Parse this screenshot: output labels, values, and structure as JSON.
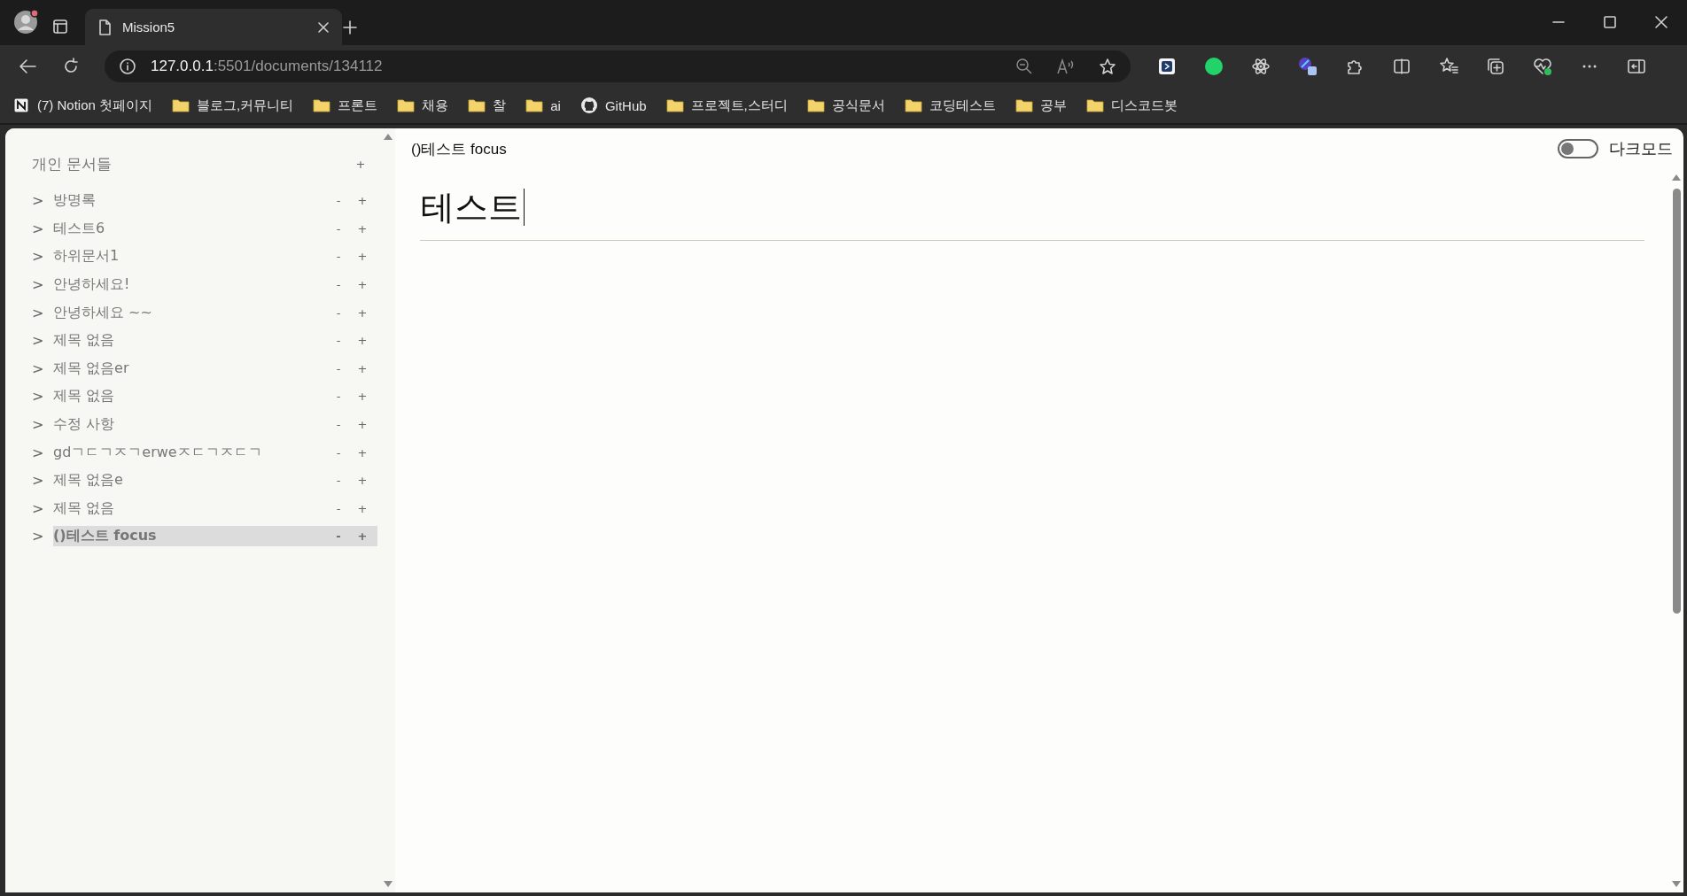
{
  "browser": {
    "tabs": [
      {
        "title": "Mission5",
        "selected": true
      }
    ],
    "address": {
      "host": "127.0.0.1",
      "path": ":5501/documents/134112"
    },
    "bookmarks": [
      {
        "kind": "notion",
        "label": "(7) Notion 첫페이지"
      },
      {
        "kind": "folder",
        "label": "블로그,커뮤니티"
      },
      {
        "kind": "folder",
        "label": "프론트"
      },
      {
        "kind": "folder",
        "label": "채용"
      },
      {
        "kind": "folder",
        "label": "찰"
      },
      {
        "kind": "folder",
        "label": "ai"
      },
      {
        "kind": "github",
        "label": "GitHub"
      },
      {
        "kind": "folder",
        "label": "프로젝트,스터디"
      },
      {
        "kind": "folder",
        "label": "공식문서"
      },
      {
        "kind": "folder",
        "label": "코딩테스트"
      },
      {
        "kind": "folder",
        "label": "공부"
      },
      {
        "kind": "folder",
        "label": "디스코드봇"
      }
    ]
  },
  "sidebar": {
    "heading": "개인 문서들",
    "add": "+",
    "documents": [
      {
        "expander": ">",
        "title": "방명록",
        "remove": "-",
        "add": "+",
        "selected": false
      },
      {
        "expander": ">",
        "title": "테스트6",
        "remove": "-",
        "add": "+",
        "selected": false
      },
      {
        "expander": ">",
        "title": "하위문서1",
        "remove": "-",
        "add": "+",
        "selected": false
      },
      {
        "expander": ">",
        "title": "안녕하세요!",
        "remove": "-",
        "add": "+",
        "selected": false
      },
      {
        "expander": ">",
        "title": "안녕하세요 ~~",
        "remove": "-",
        "add": "+",
        "selected": false
      },
      {
        "expander": ">",
        "title": "제목 없음",
        "remove": "-",
        "add": "+",
        "selected": false
      },
      {
        "expander": ">",
        "title": "제목 없음er",
        "remove": "-",
        "add": "+",
        "selected": false
      },
      {
        "expander": ">",
        "title": "제목 없음",
        "remove": "-",
        "add": "+",
        "selected": false
      },
      {
        "expander": ">",
        "title": "수정 사항",
        "remove": "-",
        "add": "+",
        "selected": false
      },
      {
        "expander": ">",
        "title": "gdㄱㄷㄱㅈㄱerweㅈㄷㄱㅈㄷㄱ",
        "remove": "-",
        "add": "+",
        "selected": false
      },
      {
        "expander": ">",
        "title": "제목 없음e",
        "remove": "-",
        "add": "+",
        "selected": false
      },
      {
        "expander": ">",
        "title": "제목 없음",
        "remove": "-",
        "add": "+",
        "selected": false
      },
      {
        "expander": ">",
        "title": "()테스트 focus",
        "remove": "-",
        "add": "+",
        "selected": true
      }
    ]
  },
  "main": {
    "breadcrumb": "()테스트 focus",
    "dark_mode": {
      "label": "다크모드",
      "on": false
    },
    "title": "테스트"
  }
}
